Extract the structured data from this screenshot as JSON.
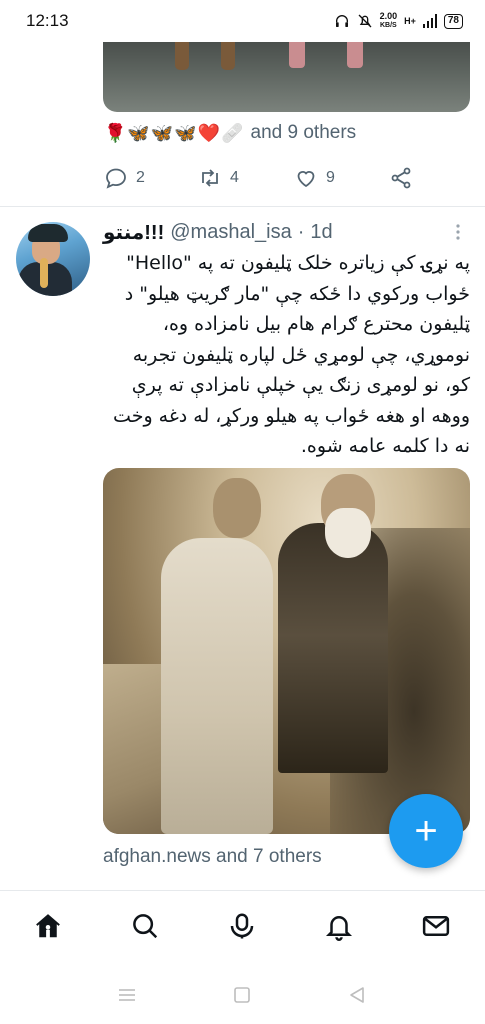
{
  "status_bar": {
    "time": "12:13",
    "net_speed_value": "2.00",
    "net_speed_unit": "KB/S",
    "signal_label": "H+",
    "battery": "78"
  },
  "first_tweet": {
    "reactions": [
      "🌹",
      "🦋",
      "🦋",
      "🦋",
      "❤️",
      "🩹"
    ],
    "reactions_others": "and 9 others",
    "reply_count": "2",
    "retweet_count": "4",
    "like_count": "9"
  },
  "second_tweet": {
    "display_name": "منتو!!!",
    "handle": "@mashal_isa",
    "separator": "·",
    "time_ago": "1d",
    "text": "په نړۍ کې زیاتره خلک ټلیفون ته په \"Hello\" ځواب ورکوي دا ځکه چې \"مار ګریټ هیلو\" د ټلیفون محترع ګرام هام بیل نامزاده وه، نوموړي، چې لومړي ځل لپاره ټلیفون تجربه کو، نو لومړی زنګ یې خپلې نامزادې ته پرې ووهه او هغه ځواب په هیلو ورکړ، له دغه وخت نه دا کلمه عامه شوه.",
    "photo_caption_tag": "afghan.news and 7 others"
  },
  "fab": {
    "label": "+"
  },
  "colors": {
    "accent": "#1d9bf0",
    "muted_text": "#536471",
    "primary_text": "#0f1419"
  },
  "bottom_nav": {
    "items": [
      "home-icon",
      "search-icon",
      "spaces-icon",
      "notifications-icon",
      "messages-icon"
    ]
  }
}
